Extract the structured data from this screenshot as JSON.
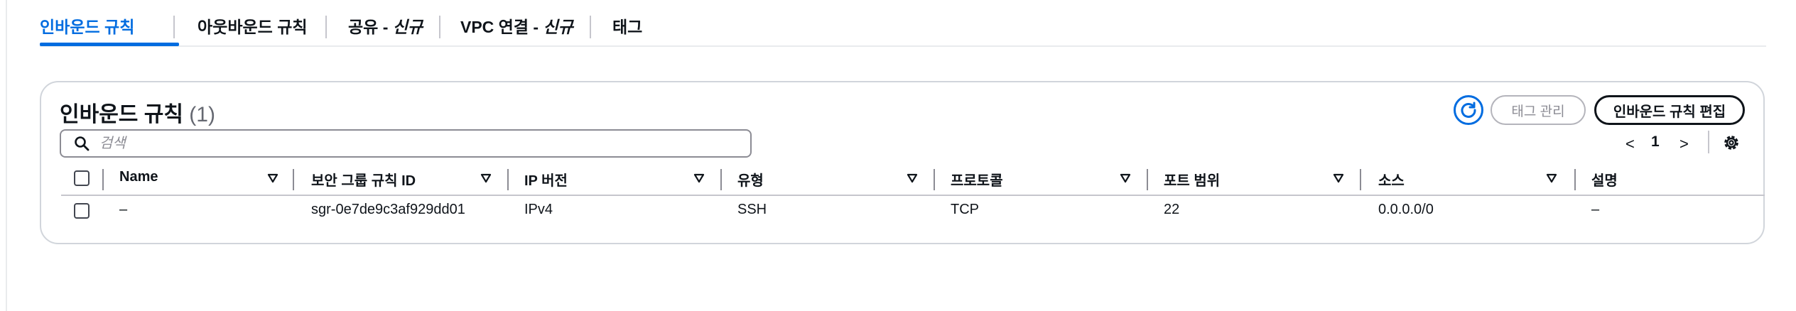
{
  "tabs": [
    {
      "label": "인바운드 규칙",
      "suffix": ""
    },
    {
      "label": "아웃바운드 규칙",
      "suffix": ""
    },
    {
      "label": "공유 - ",
      "suffix": "신규"
    },
    {
      "label": "VPC 연결 - ",
      "suffix": "신규"
    },
    {
      "label": "태그",
      "suffix": ""
    }
  ],
  "active_tab": "인바운드 규칙",
  "panel": {
    "title": "인바운드 규칙",
    "count": "(1)",
    "manage_tags_label": "태그 관리",
    "edit_rules_label": "인바운드 규칙 편집",
    "search_placeholder": "검색",
    "search_value": "",
    "page_prev": "<",
    "page_number": "1",
    "page_next": ">"
  },
  "table": {
    "columns": [
      "Name",
      "보안 그룹 규칙 ID",
      "IP 버전",
      "유형",
      "프로토콜",
      "포트 범위",
      "소스",
      "설명"
    ],
    "rows": [
      [
        "–",
        "sgr-0e7de9c3af929dd01",
        "IPv4",
        "SSH",
        "TCP",
        "22",
        "0.0.0.0/0",
        "–"
      ]
    ]
  },
  "colors": {
    "accent": "#006ce0",
    "text": "#0f141a",
    "muted": "#8c8c94",
    "border": "#d1d5db"
  },
  "icons": {
    "refresh": "refresh-icon",
    "search": "search-icon",
    "sort": "sort-down-triangle-icon",
    "settings": "gear-icon"
  }
}
